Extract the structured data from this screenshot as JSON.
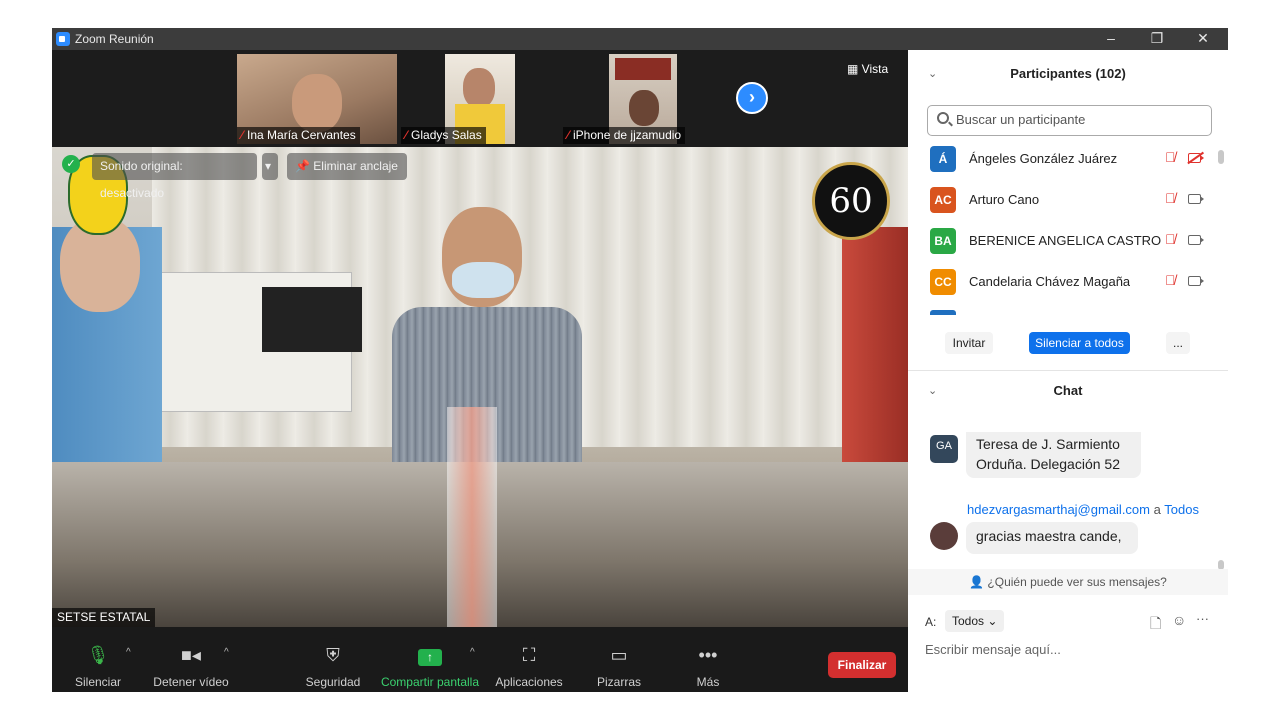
{
  "window": {
    "title": "Zoom Reunión",
    "controls": {
      "minimize": "–",
      "restore": "❐",
      "close": "✕"
    }
  },
  "thumbnails": [
    {
      "name": "Ina María Cervantes"
    },
    {
      "name": "Gladys Salas"
    },
    {
      "name": "iPhone de jjzamudio"
    }
  ],
  "next_arrow": "›",
  "view_label": "Vista",
  "video": {
    "original_sound": "Sonido original: desactivado",
    "unpin": "Eliminar anclaje",
    "main_label": "SETSE ESTATAL",
    "badge_text": "60"
  },
  "toolbar": {
    "mute": "Silenciar",
    "stop_video": "Detener vídeo",
    "security": "Seguridad",
    "share": "Compartir pantalla",
    "apps": "Aplicaciones",
    "whiteboards": "Pizarras",
    "more": "Más",
    "end": "Finalizar"
  },
  "participants": {
    "title": "Participantes (102)",
    "search_placeholder": "Buscar un participante",
    "list": [
      {
        "initials": "Á",
        "name": "Ángeles González Juárez",
        "color": "#1f6fbf",
        "video_off": true
      },
      {
        "initials": "AC",
        "name": "Arturo Cano",
        "color": "#d9541e",
        "video_off": false
      },
      {
        "initials": "BA",
        "name": "BERENICE ANGELICA CASTRO ...",
        "color": "#2aa845",
        "video_off": false
      },
      {
        "initials": "CC",
        "name": "Candelaria Chávez Magaña",
        "color": "#f08c00",
        "video_off": false
      }
    ],
    "invite": "Invitar",
    "mute_all": "Silenciar a todos",
    "more": "..."
  },
  "chat": {
    "title": "Chat",
    "messages": [
      {
        "avatar": "GA",
        "text_line1": "Teresa de J. Sarmiento",
        "text_line2": "Orduña. Delegación 52"
      },
      {
        "sender": "hdezvargasmarthaj@gmail.com",
        "to_word": "a",
        "recipient": "Todos",
        "text": "gracias maestra cande,"
      }
    ],
    "who_can_see": "¿Quién puede ver sus mensajes?",
    "to_label": "A:",
    "to_value": "Todos",
    "input_placeholder": "Escribir mensaje aquí..."
  }
}
